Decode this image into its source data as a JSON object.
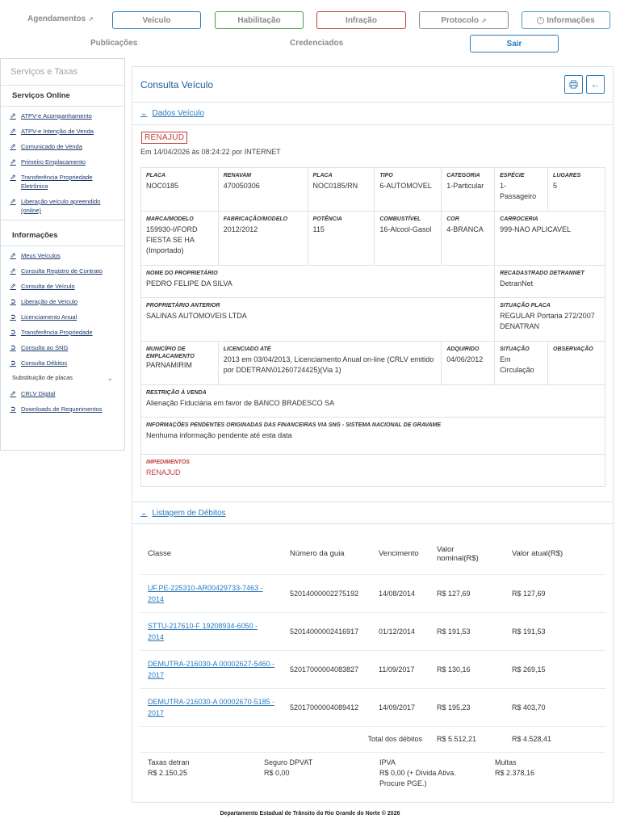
{
  "nav": {
    "agendamentos": "Agendamentos",
    "veiculo": "Veículo",
    "habilitacao": "Habilitação",
    "infracao": "Infração",
    "protocolo": "Protocolo",
    "informacoes": "Informações",
    "publicacoes": "Publicações",
    "credenciados": "Credenciados",
    "sair": "Sair"
  },
  "sidebar": {
    "title": "Serviços e Taxas",
    "online_label": "Serviços Online",
    "online_items": [
      {
        "label": "ATPV-e Acompanhamento",
        "icon": "external-link-icon"
      },
      {
        "label": "ATPV-e Intenção de Venda",
        "icon": "external-link-icon"
      },
      {
        "label": "Comunicado de Venda",
        "icon": "external-link-icon"
      },
      {
        "label": "Primeiro Emplacamento",
        "icon": "external-link-icon"
      },
      {
        "label": "Transferência Propriedade Eletrônica",
        "icon": "external-link-icon"
      },
      {
        "label": "Liberação veículo apreendido (online)",
        "icon": "external-link-icon"
      }
    ],
    "info_label": "Informações",
    "info_items": [
      {
        "label": "Meus Veículos",
        "icon": "external-link-icon"
      },
      {
        "label": "Consulta Registro de Contrato",
        "icon": "external-link-icon"
      },
      {
        "label": "Consulta de Veículo",
        "icon": "external-link-icon"
      },
      {
        "label": "Liberação de Veículo",
        "icon": "arrow-circle-icon"
      },
      {
        "label": "Licenciamento Anual",
        "icon": "arrow-circle-icon"
      },
      {
        "label": "Transferência Propriedade",
        "icon": "arrow-circle-icon"
      },
      {
        "label": "Consulta ao SNG",
        "icon": "arrow-circle-icon"
      },
      {
        "label": "Consulta Débitos",
        "icon": "arrow-circle-icon"
      }
    ],
    "substituicao": "Substituição de placas",
    "extra_items": [
      {
        "label": "CRLV Digital",
        "icon": "external-link-icon"
      },
      {
        "label": "Downloads de Requerimentos",
        "icon": "arrow-circle-icon"
      }
    ]
  },
  "main": {
    "title": "Consulta Veículo",
    "section_dados": "Dados Veículo",
    "badge": "RENAJUD",
    "emissao": "Em 14/04/2026 às 08:24:22 por INTERNET",
    "fields": {
      "placa_l": "PLACA",
      "placa_v": "NOC0185",
      "renavam_l": "RENAVAM",
      "renavam_v": "470050306",
      "placa2_l": "PLACA",
      "placa2_v": "NOC0185/RN",
      "tipo_l": "TIPO",
      "tipo_v": "6-AUTOMOVEL",
      "categoria_l": "CATEGORIA",
      "categoria_v": "1-Particular",
      "especie_l": "ESPÉCIE",
      "especie_v": "1-Passageiro",
      "lugares_l": "LUGARES",
      "lugares_v": "5",
      "marca_l": "MARCA/MODELO",
      "marca_v": "159930-I/FORD FIESTA SE HA (Importado)",
      "fabricacao_l": "FABRICAÇÃO/MODELO",
      "fabricacao_v": "2012/2012",
      "potencia_l": "POTÊNCIA",
      "potencia_v": "115",
      "combustivel_l": "COMBUSTÍVEL",
      "combustivel_v": "16-Alcool-Gasol",
      "cor_l": "COR",
      "cor_v": "4-BRANCA",
      "carroceria_l": "CARROCERIA",
      "carroceria_v": "999-NAO APLICAVEL",
      "proprietario_l": "NOME DO PROPRIETÁRIO",
      "proprietario_v": "PEDRO FELIPE DA SILVA",
      "recadastrado_l": "RECADASTRADO DETRANNET",
      "recadastrado_v": "DetranNet",
      "anterior_l": "PROPRIETÁRIO ANTERIOR",
      "anterior_v": "SALINAS AUTOMOVEIS LTDA",
      "situacao_placa_l": "SITUAÇÃO PLACA",
      "situacao_placa_v": "REGULAR Portaria 272/2007 DENATRAN",
      "municipio_l": "MUNICÍPIO DE EMPLACAMENTO",
      "municipio_v": "PARNAMIRIM",
      "licenciado_l": "LICENCIADO ATÉ",
      "licenciado_v": "2013 em 03/04/2013, Licenciamento Anual on-line (CRLV emitido por DDETRAN\\01260724425)(Via 1)",
      "adquirido_l": "ADQUIRIDO",
      "adquirido_v": "04/06/2012",
      "situacao_l": "SITUAÇÃO",
      "situacao_v": "Em Circulação",
      "observacao_l": "OBSERVAÇÃO",
      "observacao_v": "",
      "restricao_l": "RESTRIÇÃO À VENDA",
      "restricao_v": "Alienação Fiduciária em favor de BANCO BRADESCO SA",
      "sng_l": "INFORMAÇÕES PENDENTES ORIGINADAS DAS FINANCEIRAS VIA SNG - SISTEMA NACIONAL DE GRAVAME",
      "sng_v": "Nenhuma informação pendente até esta data",
      "impedimentos_l": "IMPEDIMENTOS",
      "impedimentos_v": "RENAJUD"
    },
    "section_debitos": "Listagem de Débitos",
    "debts_headers": [
      "Classe",
      "Número da guia",
      "Vencimento",
      "Valor nominal(R$)",
      "Valor atual(R$)"
    ],
    "debts": [
      {
        "classe": "UF.PE-225310-AR00429733-7463 - 2014",
        "guia": "52014000002275192",
        "venc": "14/08/2014",
        "nominal": "R$ 127,69",
        "atual": "R$ 127,69"
      },
      {
        "classe": "STTU-217610-F 19208934-6050 - 2014",
        "guia": "52014000002416917",
        "venc": "01/12/2014",
        "nominal": "R$ 191,53",
        "atual": "R$ 191,53"
      },
      {
        "classe": "DEMUTRA-216030-A 00002627-5460 - 2017",
        "guia": "52017000004083827",
        "venc": "11/09/2017",
        "nominal": "R$ 130,16",
        "atual": "R$ 269,15"
      },
      {
        "classe": "DEMUTRA-216030-A 00002670-5185 - 2017",
        "guia": "52017000004089412",
        "venc": "14/09/2017",
        "nominal": "R$ 195,23",
        "atual": "R$ 403,70"
      }
    ],
    "total_label": "Total dos débitos",
    "total_nominal": "R$ 5.512,21",
    "total_atual": "R$ 4.528,41",
    "summary": {
      "taxas_l": "Taxas detran",
      "taxas_v": "R$ 2.150,25",
      "seguro_l": "Seguro DPVAT",
      "seguro_v": "R$ 0,00",
      "ipva_l": "IPVA",
      "ipva_v": "R$ 0,00 (+ Dívida Ativa. Procure PGE.)",
      "multas_l": "Multas",
      "multas_v": "R$ 2.378,16"
    }
  },
  "footer": "Departamento Estadual de Trânsito do Rio Grande do Norte © 2026",
  "colors": {
    "accent": "#2b7bbf",
    "title": "#1f5d99",
    "alert": "#c43c3c",
    "border": "#dde3e8"
  }
}
